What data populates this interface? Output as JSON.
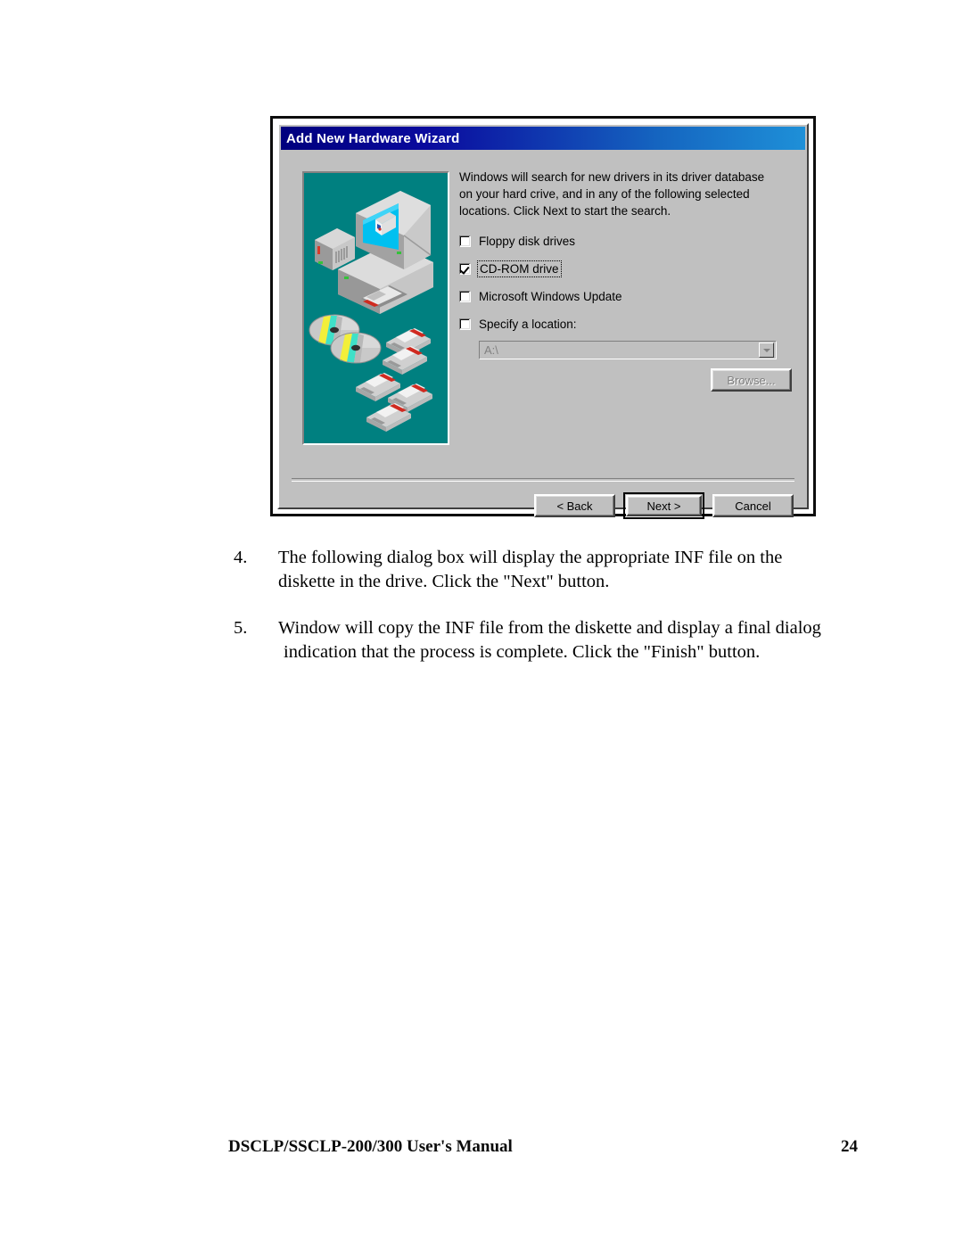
{
  "document": {
    "footer": {
      "manual_title": "DSCLP/SSCLP-200/300 User's Manual",
      "page_number": "24"
    },
    "steps": [
      {
        "number": "4.",
        "line1": "The following dialog box will display the appropriate INF file on the",
        "line2": "diskette in the drive. Click the \"Next\" button."
      },
      {
        "number": "5.",
        "line1": "Window will copy the INF file from the diskette and display a final dialog",
        "line2": "indication that the process is complete. Click the \"Finish\" button."
      }
    ]
  },
  "dialog": {
    "title": "Add New Hardware Wizard",
    "intro_text": "Windows will search for new drivers in its driver database\non your hard crive, and in any of the following selected\nlocations. Click Next to start the search.",
    "options": [
      {
        "label": "Floppy disk drives",
        "checked": false,
        "focused": false
      },
      {
        "label": "CD-ROM drive",
        "checked": true,
        "focused": true
      },
      {
        "label": "Microsoft Windows Update",
        "checked": false,
        "focused": false
      },
      {
        "label": "Specify a location:",
        "checked": false,
        "focused": false
      }
    ],
    "location_combo": {
      "value": "A:\\",
      "enabled": false
    },
    "browse_button": {
      "label": "Browse...",
      "enabled": false
    },
    "footer_buttons": [
      {
        "label": "< Back",
        "default": false
      },
      {
        "label": "Next >",
        "default": true
      },
      {
        "label": "Cancel",
        "default": false
      }
    ],
    "illustration": {
      "description": "isometric computer with monitor, CD-ROM discs and floppy diskettes",
      "background_color": "#008080",
      "screen_color": "#00c0f0"
    },
    "colors": {
      "titlebar_start": "#00007e",
      "titlebar_end": "#1e90d8",
      "face": "#c0c0c0",
      "teal_panel": "#008080"
    }
  }
}
